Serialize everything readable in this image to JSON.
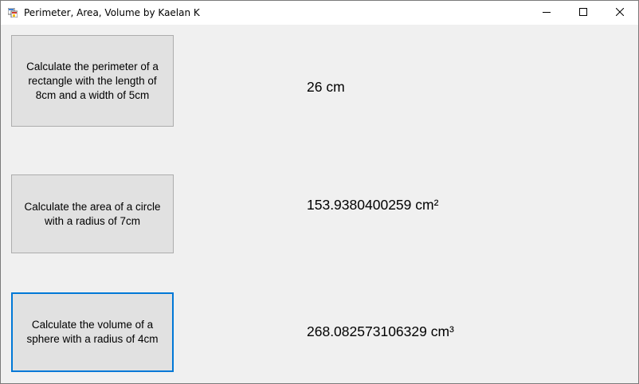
{
  "window": {
    "title": "Perimeter, Area, Volume by Kaelan K",
    "icon": "windows-form-icon",
    "controls": [
      "minimize-icon",
      "maximize-icon",
      "close-icon"
    ]
  },
  "buttons": {
    "perimeter_label": "Calculate the perimeter of a rectangle with the length of 8cm and a width of 5cm",
    "area_label": "Calculate the area of a circle with a radius of 7cm",
    "volume_label": "Calculate the volume of a sphere with a radius of 4cm"
  },
  "results": {
    "perimeter": "26 cm",
    "area": "153.9380400259 cm²",
    "volume": "268.082573106329 cm³"
  },
  "colors": {
    "focus_border": "#0078d7",
    "button_face": "#e1e1e1",
    "background": "#f0f0f0"
  }
}
